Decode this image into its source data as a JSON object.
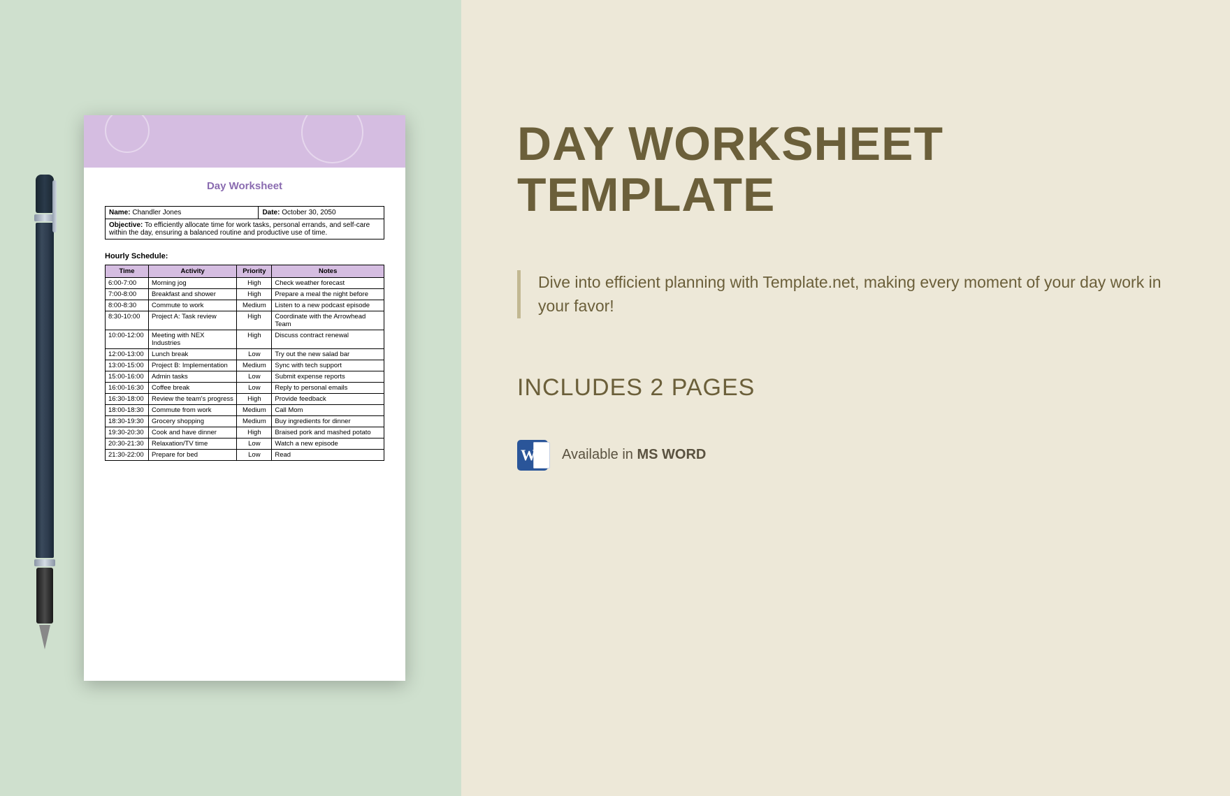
{
  "doc": {
    "title": "Day Worksheet",
    "name_label": "Name:",
    "name_value": "Chandler Jones",
    "date_label": "Date:",
    "date_value": "October 30, 2050",
    "objective_label": "Objective:",
    "objective_value": "To efficiently allocate time for work tasks, personal errands, and self-care within the day, ensuring a balanced routine and productive use of time.",
    "schedule_heading": "Hourly Schedule:",
    "columns": {
      "time": "Time",
      "activity": "Activity",
      "priority": "Priority",
      "notes": "Notes"
    },
    "rows": [
      {
        "time": "6:00-7:00",
        "activity": "Morning jog",
        "priority": "High",
        "notes": "Check weather forecast"
      },
      {
        "time": "7:00-8:00",
        "activity": "Breakfast and shower",
        "priority": "High",
        "notes": "Prepare a meal the night before"
      },
      {
        "time": "8:00-8:30",
        "activity": "Commute to work",
        "priority": "Medium",
        "notes": "Listen to a new podcast episode"
      },
      {
        "time": "8:30-10:00",
        "activity": "Project A: Task review",
        "priority": "High",
        "notes": "Coordinate with the Arrowhead Team"
      },
      {
        "time": "10:00-12:00",
        "activity": "Meeting with NEX Industries",
        "priority": "High",
        "notes": "Discuss contract renewal"
      },
      {
        "time": "12:00-13:00",
        "activity": "Lunch break",
        "priority": "Low",
        "notes": "Try out the new salad bar"
      },
      {
        "time": "13:00-15:00",
        "activity": "Project B: Implementation",
        "priority": "Medium",
        "notes": "Sync with tech support"
      },
      {
        "time": "15:00-16:00",
        "activity": "Admin tasks",
        "priority": "Low",
        "notes": "Submit expense reports"
      },
      {
        "time": "16:00-16:30",
        "activity": "Coffee break",
        "priority": "Low",
        "notes": "Reply to personal emails"
      },
      {
        "time": "16:30-18:00",
        "activity": "Review the team's progress",
        "priority": "High",
        "notes": "Provide feedback"
      },
      {
        "time": "18:00-18:30",
        "activity": "Commute from work",
        "priority": "Medium",
        "notes": "Call Mom"
      },
      {
        "time": "18:30-19:30",
        "activity": "Grocery shopping",
        "priority": "Medium",
        "notes": "Buy ingredients for dinner"
      },
      {
        "time": "19:30-20:30",
        "activity": "Cook and have dinner",
        "priority": "High",
        "notes": "Braised pork and mashed potato"
      },
      {
        "time": "20:30-21:30",
        "activity": "Relaxation/TV time",
        "priority": "Low",
        "notes": "Watch a new episode"
      },
      {
        "time": "21:30-22:00",
        "activity": "Prepare for bed",
        "priority": "Low",
        "notes": "Read"
      }
    ]
  },
  "promo": {
    "title": "DAY WORKSHEET TEMPLATE",
    "description": "Dive into efficient planning with Template.net, making every moment of your day work in your favor!",
    "includes": "INCLUDES 2 PAGES",
    "available_prefix": "Available in ",
    "available_app": "MS WORD",
    "word_letter": "W"
  }
}
